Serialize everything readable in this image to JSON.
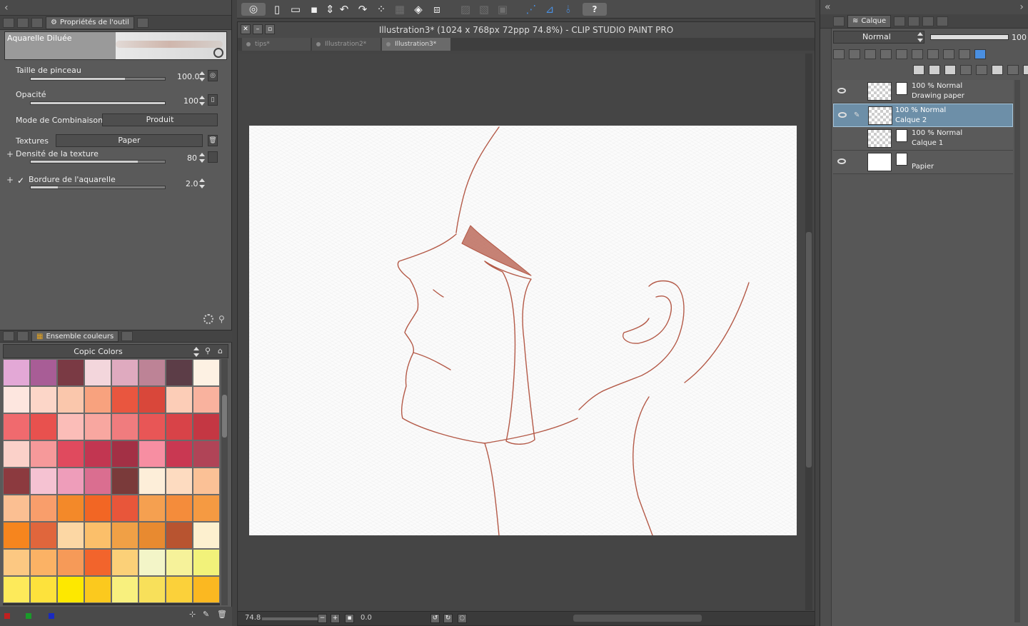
{
  "tool_properties": {
    "tab_label": "Propriétés de l'outil",
    "brush_name": "Aquarelle Diluée",
    "rows": {
      "brush_size": {
        "label": "Taille de pinceau",
        "value": "100.0",
        "fill": 0.7
      },
      "opacity": {
        "label": "Opacité",
        "value": "100",
        "fill": 1.0
      },
      "blend": {
        "label": "Mode de Combinaison",
        "value": "Produit"
      },
      "textures": {
        "label": "Textures",
        "value": "Paper"
      },
      "texture_density": {
        "label": "Densité de la texture",
        "value": "80",
        "fill": 0.8
      },
      "watercolor_edge": {
        "label": "Bordure de l'aquarelle",
        "value": "2.0",
        "fill": 0.2,
        "checked": "✓"
      }
    }
  },
  "color_set": {
    "tab_label": "Ensemble couleurs",
    "set_name": "Copic Colors",
    "swatches": [
      "#e3a8d6",
      "#a85d96",
      "#7a3a44",
      "#f3d6dc",
      "#dfaabf",
      "#bd8396",
      "#5c3d47",
      "#fdf1e3",
      "#fde6df",
      "#fcd6c8",
      "#fac7ac",
      "#f8a27e",
      "#e9563f",
      "#d9473a",
      "#fccdb7",
      "#f9b29e",
      "#f06a6e",
      "#e8514e",
      "#fbbdb8",
      "#f8a7a0",
      "#f07c7e",
      "#e85656",
      "#d84348",
      "#c43743",
      "#fbd1c9",
      "#f6999a",
      "#e04a5e",
      "#c23651",
      "#a33045",
      "#f78ea2",
      "#c93852",
      "#b04457",
      "#8c3a3f",
      "#f5c2d2",
      "#ee9dba",
      "#da6e90",
      "#7a3a3a",
      "#fdeed9",
      "#fddbc0",
      "#fbc196",
      "#fbbf92",
      "#f99e6b",
      "#f38929",
      "#f26624",
      "#e8563a",
      "#f5a050",
      "#f48c3b",
      "#f59a42",
      "#f6851e",
      "#e0663c",
      "#fcd7a4",
      "#fbbf6a",
      "#f0a046",
      "#e88a30",
      "#b85430",
      "#fdf0cf",
      "#fcc882",
      "#fbb265",
      "#f69a58",
      "#f2642c",
      "#fbd078",
      "#f3f5c8",
      "#f6f29a",
      "#f2f27a",
      "#fdea5a",
      "#fde23c",
      "#fde800",
      "#fbc91e",
      "#f8f07e",
      "#f8e05a",
      "#fbd13a",
      "#fbb821"
    ],
    "foot_colors": [
      "#c02020",
      "#1a9a2a",
      "#1a2ac0"
    ]
  },
  "toolbar": {
    "icons": [
      "clip-logo",
      "new",
      "open",
      "save",
      "save-arrow",
      "undo",
      "redo",
      "transform",
      "select",
      "fill-bucket",
      "crop",
      "dim1",
      "dim2",
      "dim3",
      "ruler-snap",
      "special-ruler",
      "pen-snap",
      "help"
    ]
  },
  "document": {
    "title": "Illustration3* (1024 x 768px 72ppp 74.8%)  - CLIP STUDIO PAINT PRO",
    "tabs": [
      {
        "label": "tips*",
        "active": false
      },
      {
        "label": "Illustration2*",
        "active": false
      },
      {
        "label": "Illustration3*",
        "active": true
      }
    ],
    "zoom": "74.8",
    "rotation": "0.0",
    "stroke_color": "#b45a48"
  },
  "layer_panel": {
    "tab_label": "Calque",
    "blend_mode": "Normal",
    "opacity": "100",
    "layers": [
      {
        "line1": "100 % Normal",
        "line2": "Drawing paper",
        "selected": false
      },
      {
        "line1": "100 % Normal",
        "line2": "Calque 2",
        "selected": true
      },
      {
        "line1": "100 % Normal",
        "line2": "Calque 1",
        "selected": false
      },
      {
        "line1": "",
        "line2": "Papier",
        "selected": false
      }
    ]
  }
}
